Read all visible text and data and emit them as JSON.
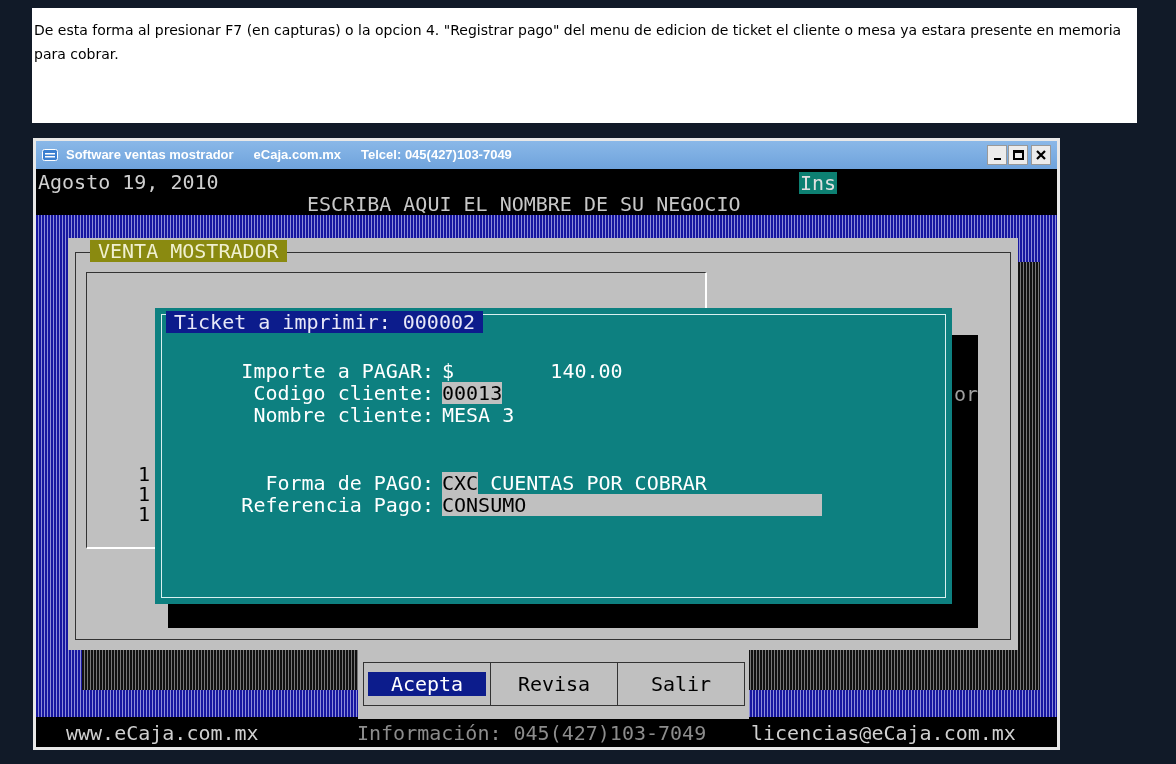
{
  "caption": "De esta forma al presionar F7 (en capturas) o la opcion 4. \"Registrar pago\" del menu de edicion de ticket el cliente o mesa ya estara presente en memoria para cobrar.",
  "window": {
    "title_parts": [
      "Software ventas mostrador",
      "eCaja.com.mx",
      "Telcel: 045(427)103-7049"
    ]
  },
  "header": {
    "date": "Agosto 19, 2010",
    "mode": "Ins",
    "business": "ESCRIBA AQUI EL NOMBRE DE SU NEGOCIO"
  },
  "panel": {
    "title": "VENTA MOSTRADOR",
    "row_fragments": [
      "1",
      "1",
      "1"
    ],
    "side_fragment": "or"
  },
  "dialog": {
    "title": "Ticket a imprimir: 000002",
    "fields": [
      {
        "label": "Importe a PAGAR:",
        "kind": "text",
        "value": "$        140.00"
      },
      {
        "label": "Codigo cliente:",
        "kind": "field",
        "value": "00013"
      },
      {
        "label": "Nombre cliente:",
        "kind": "text",
        "value": "MESA 3"
      },
      {
        "kind": "gap"
      },
      {
        "label": "Forma de PAGO:",
        "kind": "coded",
        "value": "CXC",
        "description": "CUENTAS POR COBRAR"
      },
      {
        "label": "Referencia Pago:",
        "kind": "wide_field",
        "value": "CONSUMO"
      }
    ]
  },
  "buttons": [
    {
      "label": "Acepta",
      "selected": true
    },
    {
      "label": "Revisa",
      "selected": false
    },
    {
      "label": "Salir",
      "selected": false
    }
  ],
  "footer": [
    "www.eCaja.com.mx",
    "Información: 045(427)103-7049",
    "licencias@eCaja.com.mx"
  ]
}
